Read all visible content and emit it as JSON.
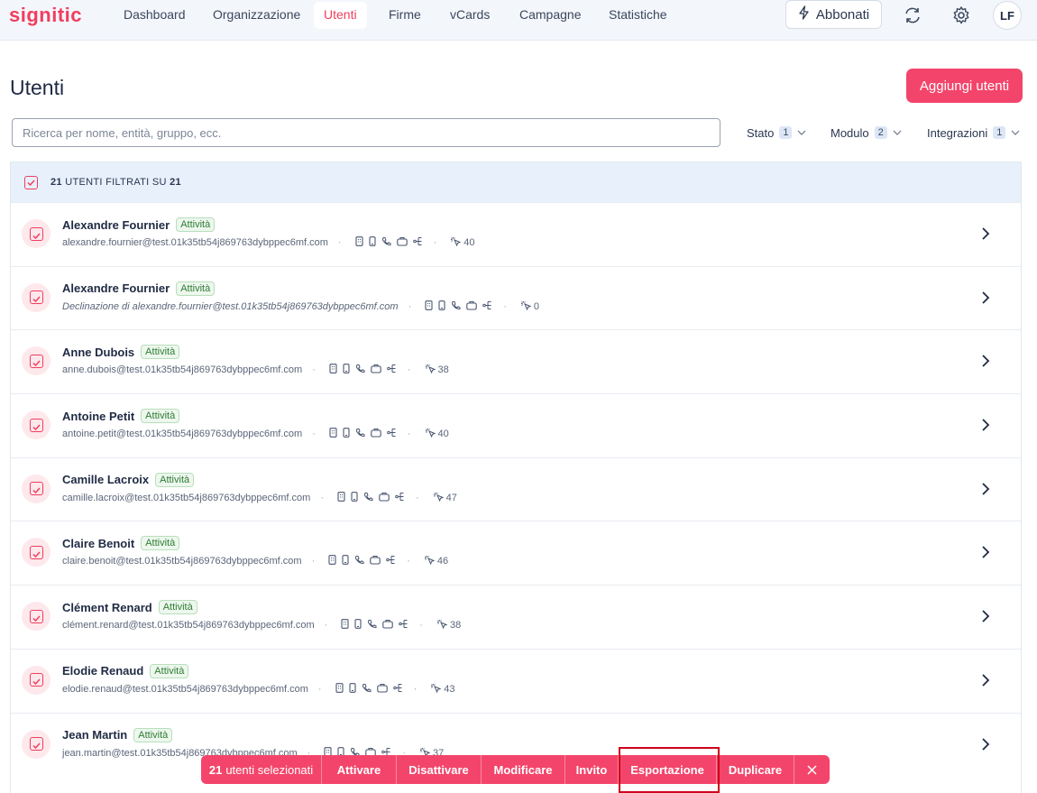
{
  "app": {
    "logo": "signitic"
  },
  "nav": {
    "items": [
      {
        "label": "Dashboard",
        "active": false
      },
      {
        "label": "Organizzazione",
        "active": false
      },
      {
        "label": "Utenti",
        "active": true
      },
      {
        "label": "Firme",
        "active": false
      },
      {
        "label": "vCards",
        "active": false
      },
      {
        "label": "Campagne",
        "active": false
      },
      {
        "label": "Statistiche",
        "active": false
      }
    ],
    "subscribe_label": "Abbonati",
    "avatar_initials": "LF"
  },
  "page": {
    "title": "Utenti",
    "add_button": "Aggiungi utenti",
    "search_placeholder": "Ricerca per nome, entità, gruppo, ecc."
  },
  "filters": [
    {
      "label": "Stato",
      "count": "1"
    },
    {
      "label": "Modulo",
      "count": "2"
    },
    {
      "label": "Integrazioni",
      "count": "1"
    }
  ],
  "list_header": {
    "filtered": "21",
    "text": "UTENTI FILTRATI SU",
    "total": "21"
  },
  "users": [
    {
      "name": "Alexandre Fournier",
      "status": "Attività",
      "email": "alexandre.fournier@test.01k35tb54j869763dybppec6mf.com",
      "italic": false,
      "clicks": "40"
    },
    {
      "name": "Alexandre Fournier",
      "status": "Attività",
      "email": "Declinazione di alexandre.fournier@test.01k35tb54j869763dybppec6mf.com",
      "italic": true,
      "clicks": "0"
    },
    {
      "name": "Anne Dubois",
      "status": "Attività",
      "email": "anne.dubois@test.01k35tb54j869763dybppec6mf.com",
      "italic": false,
      "clicks": "38"
    },
    {
      "name": "Antoine Petit",
      "status": "Attività",
      "email": "antoine.petit@test.01k35tb54j869763dybppec6mf.com",
      "italic": false,
      "clicks": "40"
    },
    {
      "name": "Camille Lacroix",
      "status": "Attività",
      "email": "camille.lacroix@test.01k35tb54j869763dybppec6mf.com",
      "italic": false,
      "clicks": "47"
    },
    {
      "name": "Claire Benoit",
      "status": "Attività",
      "email": "claire.benoit@test.01k35tb54j869763dybppec6mf.com",
      "italic": false,
      "clicks": "46"
    },
    {
      "name": "Clément Renard",
      "status": "Attività",
      "email": "clément.renard@test.01k35tb54j869763dybppec6mf.com",
      "italic": false,
      "clicks": "38"
    },
    {
      "name": "Elodie Renaud",
      "status": "Attività",
      "email": "elodie.renaud@test.01k35tb54j869763dybppec6mf.com",
      "italic": false,
      "clicks": "43"
    },
    {
      "name": "Jean Martin",
      "status": "Attività",
      "email": "jean.martin@test.01k35tb54j869763dybppec6mf.com",
      "italic": false,
      "clicks": "37"
    }
  ],
  "row_icons": [
    "building-icon",
    "mobile-icon",
    "phone-icon",
    "briefcase-icon",
    "org-tree-icon"
  ],
  "actions": {
    "selected_count": "21",
    "selected_text": "utenti selezionati",
    "items": [
      "Attivare",
      "Disattivare",
      "Modificare",
      "Invito",
      "Esportazione",
      "Duplicare"
    ],
    "close_icon": "close-icon"
  },
  "colors": {
    "brand": "#f13e5f",
    "action_bar": "#f3456b",
    "badge_green": "#2e7d32",
    "highlight": "#d0021b"
  }
}
